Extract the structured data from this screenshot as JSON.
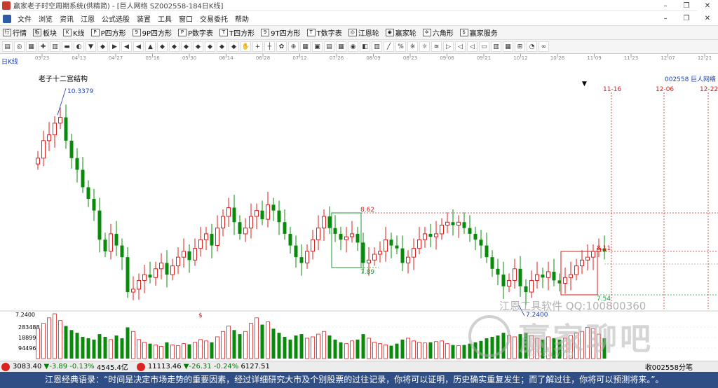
{
  "window": {
    "title": "赢家老子时空周期系统(供精简) - [巨人网络  SZ002558-184日K线]",
    "controls": [
      "–",
      "❐",
      "✕"
    ]
  },
  "menu": {
    "items": [
      "文件",
      "浏览",
      "资讯",
      "江恩",
      "公式选股",
      "装置",
      "工具",
      "窗口",
      "交易委托",
      "帮助"
    ],
    "right_controls": [
      "–",
      "❐",
      "✕"
    ]
  },
  "toolbar1": {
    "items": [
      {
        "label": "行情",
        "icon": "行"
      },
      {
        "label": "板块",
        "icon": "板"
      },
      {
        "label": "K线",
        "icon": "K"
      },
      {
        "label": "P四方形",
        "icon": "P"
      },
      {
        "label": "9P四方形",
        "icon": "9"
      },
      {
        "label": "P数字表",
        "icon": "P"
      },
      {
        "label": "T四方形",
        "icon": "T"
      },
      {
        "label": "9T四方形",
        "icon": "9"
      },
      {
        "label": "T数字表",
        "icon": "T"
      },
      {
        "label": "江恩轮",
        "icon": "◎"
      },
      {
        "label": "赢家轮",
        "icon": "◉"
      },
      {
        "label": "六角形",
        "icon": "✡"
      },
      {
        "label": "赢家服务",
        "icon": "$"
      }
    ]
  },
  "toolbar2": {
    "icons": [
      "▤",
      "◎",
      "▦",
      "✚",
      "▥",
      "▬",
      "◐",
      "▼",
      "◆",
      "▶",
      "◀",
      "◀",
      "▲",
      "◆",
      "◆",
      "◆",
      "◆",
      "◆",
      "◆",
      "◆",
      "✋",
      "+",
      "┼",
      "✿",
      "⊕",
      "▦",
      "▣",
      "▤",
      "▦",
      "◉",
      "◧",
      "▥",
      "╱",
      "%",
      "※",
      "☼",
      "≋",
      "▷",
      "◁",
      "◁",
      "▭",
      "▥",
      "▦",
      "⊞",
      "◔",
      "∞"
    ]
  },
  "time_axis": {
    "labels": [
      "03-23",
      "04-13",
      "04-27",
      "05-16",
      "05-30",
      "06-14",
      "06-28",
      "07-12",
      "07-26",
      "08-09",
      "08-23",
      "09-06",
      "09-21",
      "10-12",
      "10-26",
      "11-09",
      "11-23",
      "12-07",
      "12-21"
    ]
  },
  "chart_header": {
    "mode_label": "日K线",
    "indicator_name": "老子十二宫结构",
    "stock_code": "002558",
    "stock_name": "巨人网络",
    "dropdown_glyph": "▼"
  },
  "chart_data": {
    "type": "candlestick",
    "high_label": "10.3379",
    "low_label": "7.2400",
    "level_labels": [
      "8.62",
      "7.89",
      "8.11",
      "7.54"
    ],
    "date_markers": [
      "11-16",
      "12-06",
      "12-22"
    ],
    "volume_axis_labels": [
      "7.2400",
      "283488",
      "188992",
      "94496"
    ],
    "marker_dollar": "$",
    "colors": {
      "up": "#e11d1d",
      "down": "#0a8a0a",
      "level": "#d22222",
      "box": "#1f9a3a"
    },
    "price_range": [
      7.0,
      10.8
    ],
    "closes": [
      9.6,
      9.9,
      10.0,
      10.2,
      10.3,
      9.9,
      9.6,
      9.4,
      9.1,
      8.9,
      8.7,
      8.2,
      8.0,
      8.3,
      8.1,
      7.9,
      7.3,
      7.35,
      7.5,
      7.6,
      7.55,
      7.7,
      7.8,
      7.6,
      7.75,
      7.9,
      8.0,
      7.85,
      8.05,
      8.2,
      8.3,
      8.1,
      8.4,
      8.6,
      8.75,
      8.5,
      8.3,
      8.4,
      8.6,
      8.7,
      8.55,
      8.8,
      8.7,
      8.5,
      8.3,
      8.1,
      7.9,
      7.8,
      8.0,
      8.2,
      8.4,
      8.6,
      8.4,
      8.3,
      8.2,
      8.25,
      8.3,
      8.15,
      7.8,
      7.85,
      7.95,
      8.0,
      8.2,
      8.1,
      8.05,
      7.8,
      7.9,
      8.05,
      8.2,
      8.3,
      8.25,
      8.3,
      8.45,
      8.5,
      8.45,
      8.5,
      8.4,
      8.3,
      8.2,
      8.1,
      7.9,
      7.7,
      7.6,
      7.4,
      7.5,
      7.7,
      7.4,
      7.3,
      7.5,
      7.6,
      7.55,
      7.65,
      7.5,
      7.45,
      7.55,
      7.6,
      7.75,
      7.85,
      7.9,
      8.0,
      8.05,
      8.0
    ],
    "volumes": [
      220,
      260,
      300,
      330,
      280,
      240,
      210,
      190,
      160,
      150,
      140,
      180,
      160,
      140,
      170,
      150,
      230,
      200,
      140,
      120,
      110,
      100,
      90,
      120,
      100,
      95,
      110,
      105,
      120,
      140,
      130,
      120,
      160,
      200,
      240,
      210,
      180,
      200,
      260,
      300,
      250,
      270,
      220,
      190,
      160,
      140,
      170,
      180,
      150,
      160,
      180,
      200,
      170,
      140,
      120,
      110,
      130,
      140,
      180,
      150,
      120,
      110,
      100,
      95,
      110,
      140,
      150,
      130,
      120,
      115,
      120,
      125,
      130,
      110,
      100,
      95,
      100,
      110,
      120,
      130,
      150,
      160,
      170,
      190,
      170,
      160,
      180,
      190,
      170,
      150,
      140,
      160,
      150,
      140,
      150,
      170,
      190,
      200,
      230,
      220,
      180,
      150
    ]
  },
  "bottom_bar": {
    "sh_index": "3083.40",
    "sh_change": "▼-3.89",
    "sh_pct": "-0.13%",
    "sh_amount": "4545.4亿",
    "sz_index": "11113.46",
    "sz_change": "▼-26.31",
    "sz_pct": "-0.24%",
    "sz_amount": "6127.51",
    "right_text": "收002558分笔"
  },
  "watermark": {
    "top_line": "江恩工具软件 QQ:100800360",
    "main_text": "赢家聊吧",
    "sub_text": "liaoba.ying"
  },
  "quote": {
    "text": "江恩经典语录：“时间是决定市场走势的重要因素，经过详细研究大市及个别股票的过往记录，你将可以证明，历史确实重复发生；而了解过往，你将可以预测将来。”。"
  }
}
